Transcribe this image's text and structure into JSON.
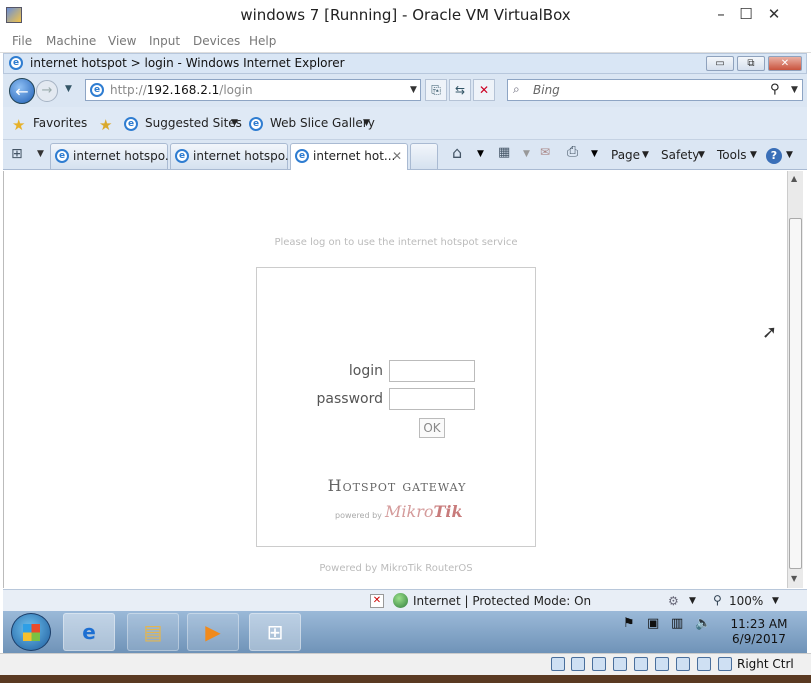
{
  "vbox": {
    "title": "windows 7 [Running] - Oracle VM VirtualBox",
    "menu": [
      "File",
      "Machine",
      "View",
      "Input",
      "Devices",
      "Help"
    ],
    "host_key": "Right Ctrl"
  },
  "ie": {
    "window_title": "internet hotspot > login - Windows Internet Explorer",
    "address_prefix": "http://",
    "address_host": "192.168.2.1",
    "address_path": "/login",
    "search_placeholder": "Bing",
    "favorites_label": "Favorites",
    "suggested_sites": "Suggested Sites",
    "web_slice_gallery": "Web Slice Gallery",
    "tabs": [
      "internet hotspo...",
      "internet hotspo...",
      "internet hot..."
    ],
    "commands": [
      "Page",
      "Safety",
      "Tools"
    ],
    "status_zone": "Internet | Protected Mode: On",
    "zoom": "100%"
  },
  "page": {
    "hint": "Please log on to use the internet hotspot service",
    "login_label": "login",
    "password_label": "password",
    "ok_label": "OK",
    "gateway_title": "Hotspot gateway",
    "powered_small": "powered by",
    "brand_a": "Mikro",
    "brand_b": "Tik",
    "footer": "Powered by MikroTik RouterOS"
  },
  "taskbar": {
    "time": "11:23 AM",
    "date": "6/9/2017"
  },
  "colors": {
    "ie_chrome": "#dbe6f3",
    "mikrotik": "#c87b7b",
    "taskbar": "#7fa3c8"
  }
}
